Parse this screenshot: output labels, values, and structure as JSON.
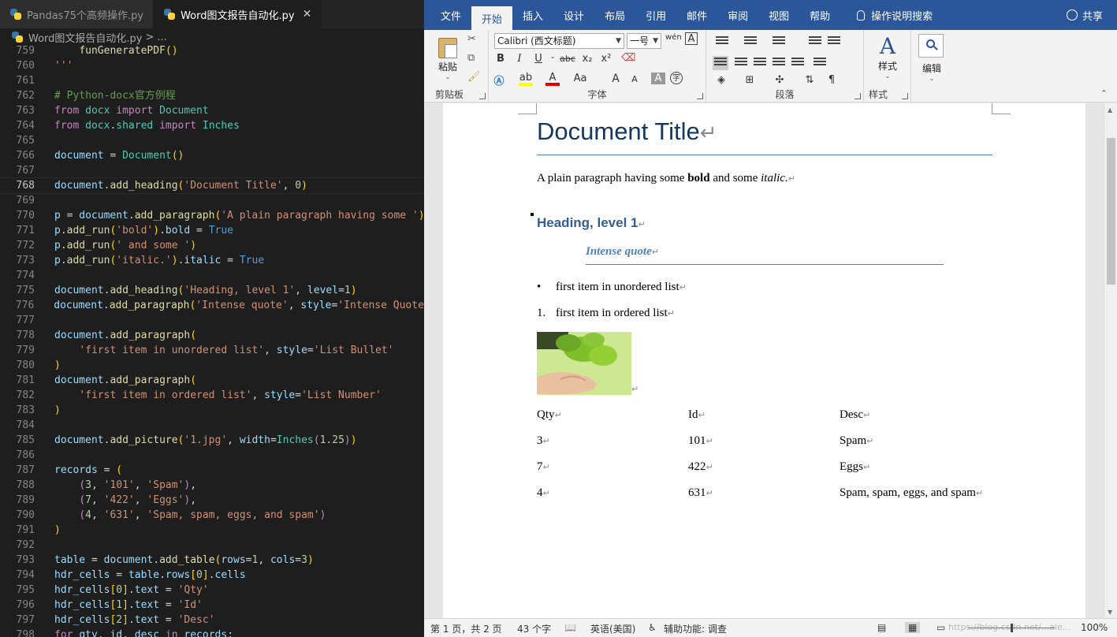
{
  "editor": {
    "tabs": [
      {
        "label": "Pandas75个高频操作.py",
        "active": false
      },
      {
        "label": "Word图文报告自动化.py",
        "active": true
      }
    ],
    "close_glyph": "✕",
    "breadcrumb": {
      "file": "Word图文报告自动化.py",
      "sep": ">",
      "more": "..."
    },
    "lines": [
      {
        "n": "759",
        "html": "    <span class='fn'>funGeneratePDF</span><span class='brk'>()</span>"
      },
      {
        "n": "760",
        "html": "<span class='str'>'''</span>"
      },
      {
        "n": "761",
        "html": ""
      },
      {
        "n": "762",
        "html": "<span class='cm'># Python-docx官方例程</span>"
      },
      {
        "n": "763",
        "html": "<span class='kw'>from</span> <span class='cls'>docx</span> <span class='kw'>import</span> <span class='cls'>Document</span>"
      },
      {
        "n": "764",
        "html": "<span class='kw'>from</span> <span class='cls'>docx</span>.<span class='cls'>shared</span> <span class='kw'>import</span> <span class='cls'>Inches</span>"
      },
      {
        "n": "765",
        "html": ""
      },
      {
        "n": "766",
        "html": "<span class='id'>document</span> = <span class='cls'>Document</span><span class='brk'>()</span>"
      },
      {
        "n": "767",
        "html": ""
      },
      {
        "n": "768",
        "html": "<span class='id'>document</span>.<span class='fn'>add_heading</span><span class='brk'>(</span><span class='str'>'Document Title'</span>, <span class='num'>0</span><span class='brk'>)</span>",
        "current": true
      },
      {
        "n": "769",
        "html": ""
      },
      {
        "n": "770",
        "html": "<span class='id'>p</span> = <span class='id'>document</span>.<span class='fn'>add_paragraph</span><span class='brk'>(</span><span class='str'>'A plain paragraph having some '</span><span class='brk'>)</span>"
      },
      {
        "n": "771",
        "html": "<span class='id'>p</span>.<span class='fn'>add_run</span><span class='brk'>(</span><span class='str'>'bold'</span><span class='brk'>)</span>.<span class='id'>bold</span> = <span class='bool'>True</span>"
      },
      {
        "n": "772",
        "html": "<span class='id'>p</span>.<span class='fn'>add_run</span><span class='brk'>(</span><span class='str'>' and some '</span><span class='brk'>)</span>"
      },
      {
        "n": "773",
        "html": "<span class='id'>p</span>.<span class='fn'>add_run</span><span class='brk'>(</span><span class='str'>'italic.'</span><span class='brk'>)</span>.<span class='id'>italic</span> = <span class='bool'>True</span>"
      },
      {
        "n": "774",
        "html": ""
      },
      {
        "n": "775",
        "html": "<span class='id'>document</span>.<span class='fn'>add_heading</span><span class='brk'>(</span><span class='str'>'Heading, level 1'</span>, <span class='id'>level</span>=<span class='num'>1</span><span class='brk'>)</span>"
      },
      {
        "n": "776",
        "html": "<span class='id'>document</span>.<span class='fn'>add_paragraph</span><span class='brk'>(</span><span class='str'>'Intense quote'</span>, <span class='id'>style</span>=<span class='str'>'Intense Quote'</span>"
      },
      {
        "n": "777",
        "html": ""
      },
      {
        "n": "778",
        "html": "<span class='id'>document</span>.<span class='fn'>add_paragraph</span><span class='brk'>(</span>"
      },
      {
        "n": "779",
        "html": "    <span class='str'>'first item in unordered list'</span>, <span class='id'>style</span>=<span class='str'>'List Bullet'</span>"
      },
      {
        "n": "780",
        "html": "<span class='brk'>)</span>"
      },
      {
        "n": "781",
        "html": "<span class='id'>document</span>.<span class='fn'>add_paragraph</span><span class='brk'>(</span>"
      },
      {
        "n": "782",
        "html": "    <span class='str'>'first item in ordered list'</span>, <span class='id'>style</span>=<span class='str'>'List Number'</span>"
      },
      {
        "n": "783",
        "html": "<span class='brk'>)</span>"
      },
      {
        "n": "784",
        "html": ""
      },
      {
        "n": "785",
        "html": "<span class='id'>document</span>.<span class='fn'>add_picture</span><span class='brk'>(</span><span class='str'>'1.jpg'</span>, <span class='id'>width</span>=<span class='cls'>Inches</span><span class='kw'>(</span><span class='num'>1.25</span><span class='kw'>)</span><span class='brk'>)</span>"
      },
      {
        "n": "786",
        "html": ""
      },
      {
        "n": "787",
        "html": "<span class='id'>records</span> = <span class='brk'>(</span>"
      },
      {
        "n": "788",
        "html": "    <span class='kw'>(</span><span class='num'>3</span>, <span class='str'>'101'</span>, <span class='str'>'Spam'</span><span class='kw'>)</span>,"
      },
      {
        "n": "789",
        "html": "    <span class='kw'>(</span><span class='num'>7</span>, <span class='str'>'422'</span>, <span class='str'>'Eggs'</span><span class='kw'>)</span>,"
      },
      {
        "n": "790",
        "html": "    <span class='kw'>(</span><span class='num'>4</span>, <span class='str'>'631'</span>, <span class='str'>'Spam, spam, eggs, and spam'</span><span class='kw'>)</span>"
      },
      {
        "n": "791",
        "html": "<span class='brk'>)</span>"
      },
      {
        "n": "792",
        "html": ""
      },
      {
        "n": "793",
        "html": "<span class='id'>table</span> = <span class='id'>document</span>.<span class='fn'>add_table</span><span class='brk'>(</span><span class='id'>rows</span>=<span class='num'>1</span>, <span class='id'>cols</span>=<span class='num'>3</span><span class='brk'>)</span>"
      },
      {
        "n": "794",
        "html": "<span class='id'>hdr_cells</span> = <span class='id'>table</span>.<span class='id'>rows</span><span class='brk'>[</span><span class='num'>0</span><span class='brk'>]</span>.<span class='id'>cells</span>"
      },
      {
        "n": "795",
        "html": "<span class='id'>hdr_cells</span><span class='brk'>[</span><span class='num'>0</span><span class='brk'>]</span>.<span class='id'>text</span> = <span class='str'>'Qty'</span>"
      },
      {
        "n": "796",
        "html": "<span class='id'>hdr_cells</span><span class='brk'>[</span><span class='num'>1</span><span class='brk'>]</span>.<span class='id'>text</span> = <span class='str'>'Id'</span>"
      },
      {
        "n": "797",
        "html": "<span class='id'>hdr_cells</span><span class='brk'>[</span><span class='num'>2</span><span class='brk'>]</span>.<span class='id'>text</span> = <span class='str'>'Desc'</span>"
      },
      {
        "n": "798",
        "html": "<span class='kw'>for</span> <span class='id'>qty</span>, <span class='id'>id</span>, <span class='id'>desc</span> <span class='kw'>in</span> <span class='id'>records</span>:"
      }
    ]
  },
  "word": {
    "ribbon_tabs": [
      "文件",
      "开始",
      "插入",
      "设计",
      "布局",
      "引用",
      "邮件",
      "审阅",
      "视图",
      "帮助"
    ],
    "active_tab": "开始",
    "tell_me": "操作说明搜索",
    "share": "共享",
    "clipboard": {
      "paste": "粘贴",
      "label": "剪贴板"
    },
    "font": {
      "name": "Calibri (西文标题)",
      "size": "一号",
      "label": "字体",
      "bold": "B",
      "italic": "I",
      "underline": "U",
      "strike": "abc",
      "sub": "x₂",
      "sup": "x²",
      "aa": "Aa",
      "grow": "A",
      "shrink": "A",
      "clear": "A",
      "wen": "wén",
      "border_a": "A",
      "circle": "字"
    },
    "paragraph": {
      "label": "段落"
    },
    "styles": {
      "button": "样式",
      "label": "样式"
    },
    "editing": {
      "button": "编辑"
    },
    "document": {
      "title": "Document Title",
      "para_pre": "A plain paragraph having some ",
      "para_bold": "bold",
      "para_mid": " and some ",
      "para_italic": "italic.",
      "heading1": "Heading, level 1",
      "quote": "Intense quote",
      "bullet_marker": "•",
      "bullet_item": "first item in unordered list",
      "number_marker": "1.",
      "number_item": "first item in ordered list",
      "pilcrow": "↵",
      "table": {
        "header": [
          "Qty",
          "Id",
          "Desc"
        ],
        "rows": [
          [
            "3",
            "101",
            "Spam"
          ],
          [
            "7",
            "422",
            "Eggs"
          ],
          [
            "4",
            "631",
            "Spam, spam, eggs, and spam"
          ]
        ]
      }
    },
    "status": {
      "page": "第 1 页，共 2 页",
      "words": "43 个字",
      "lang": "英语(美国)",
      "access": "辅助功能: 调查",
      "zoom": "100%",
      "watermark": "https://blog.csdn.net/...ale..."
    }
  }
}
